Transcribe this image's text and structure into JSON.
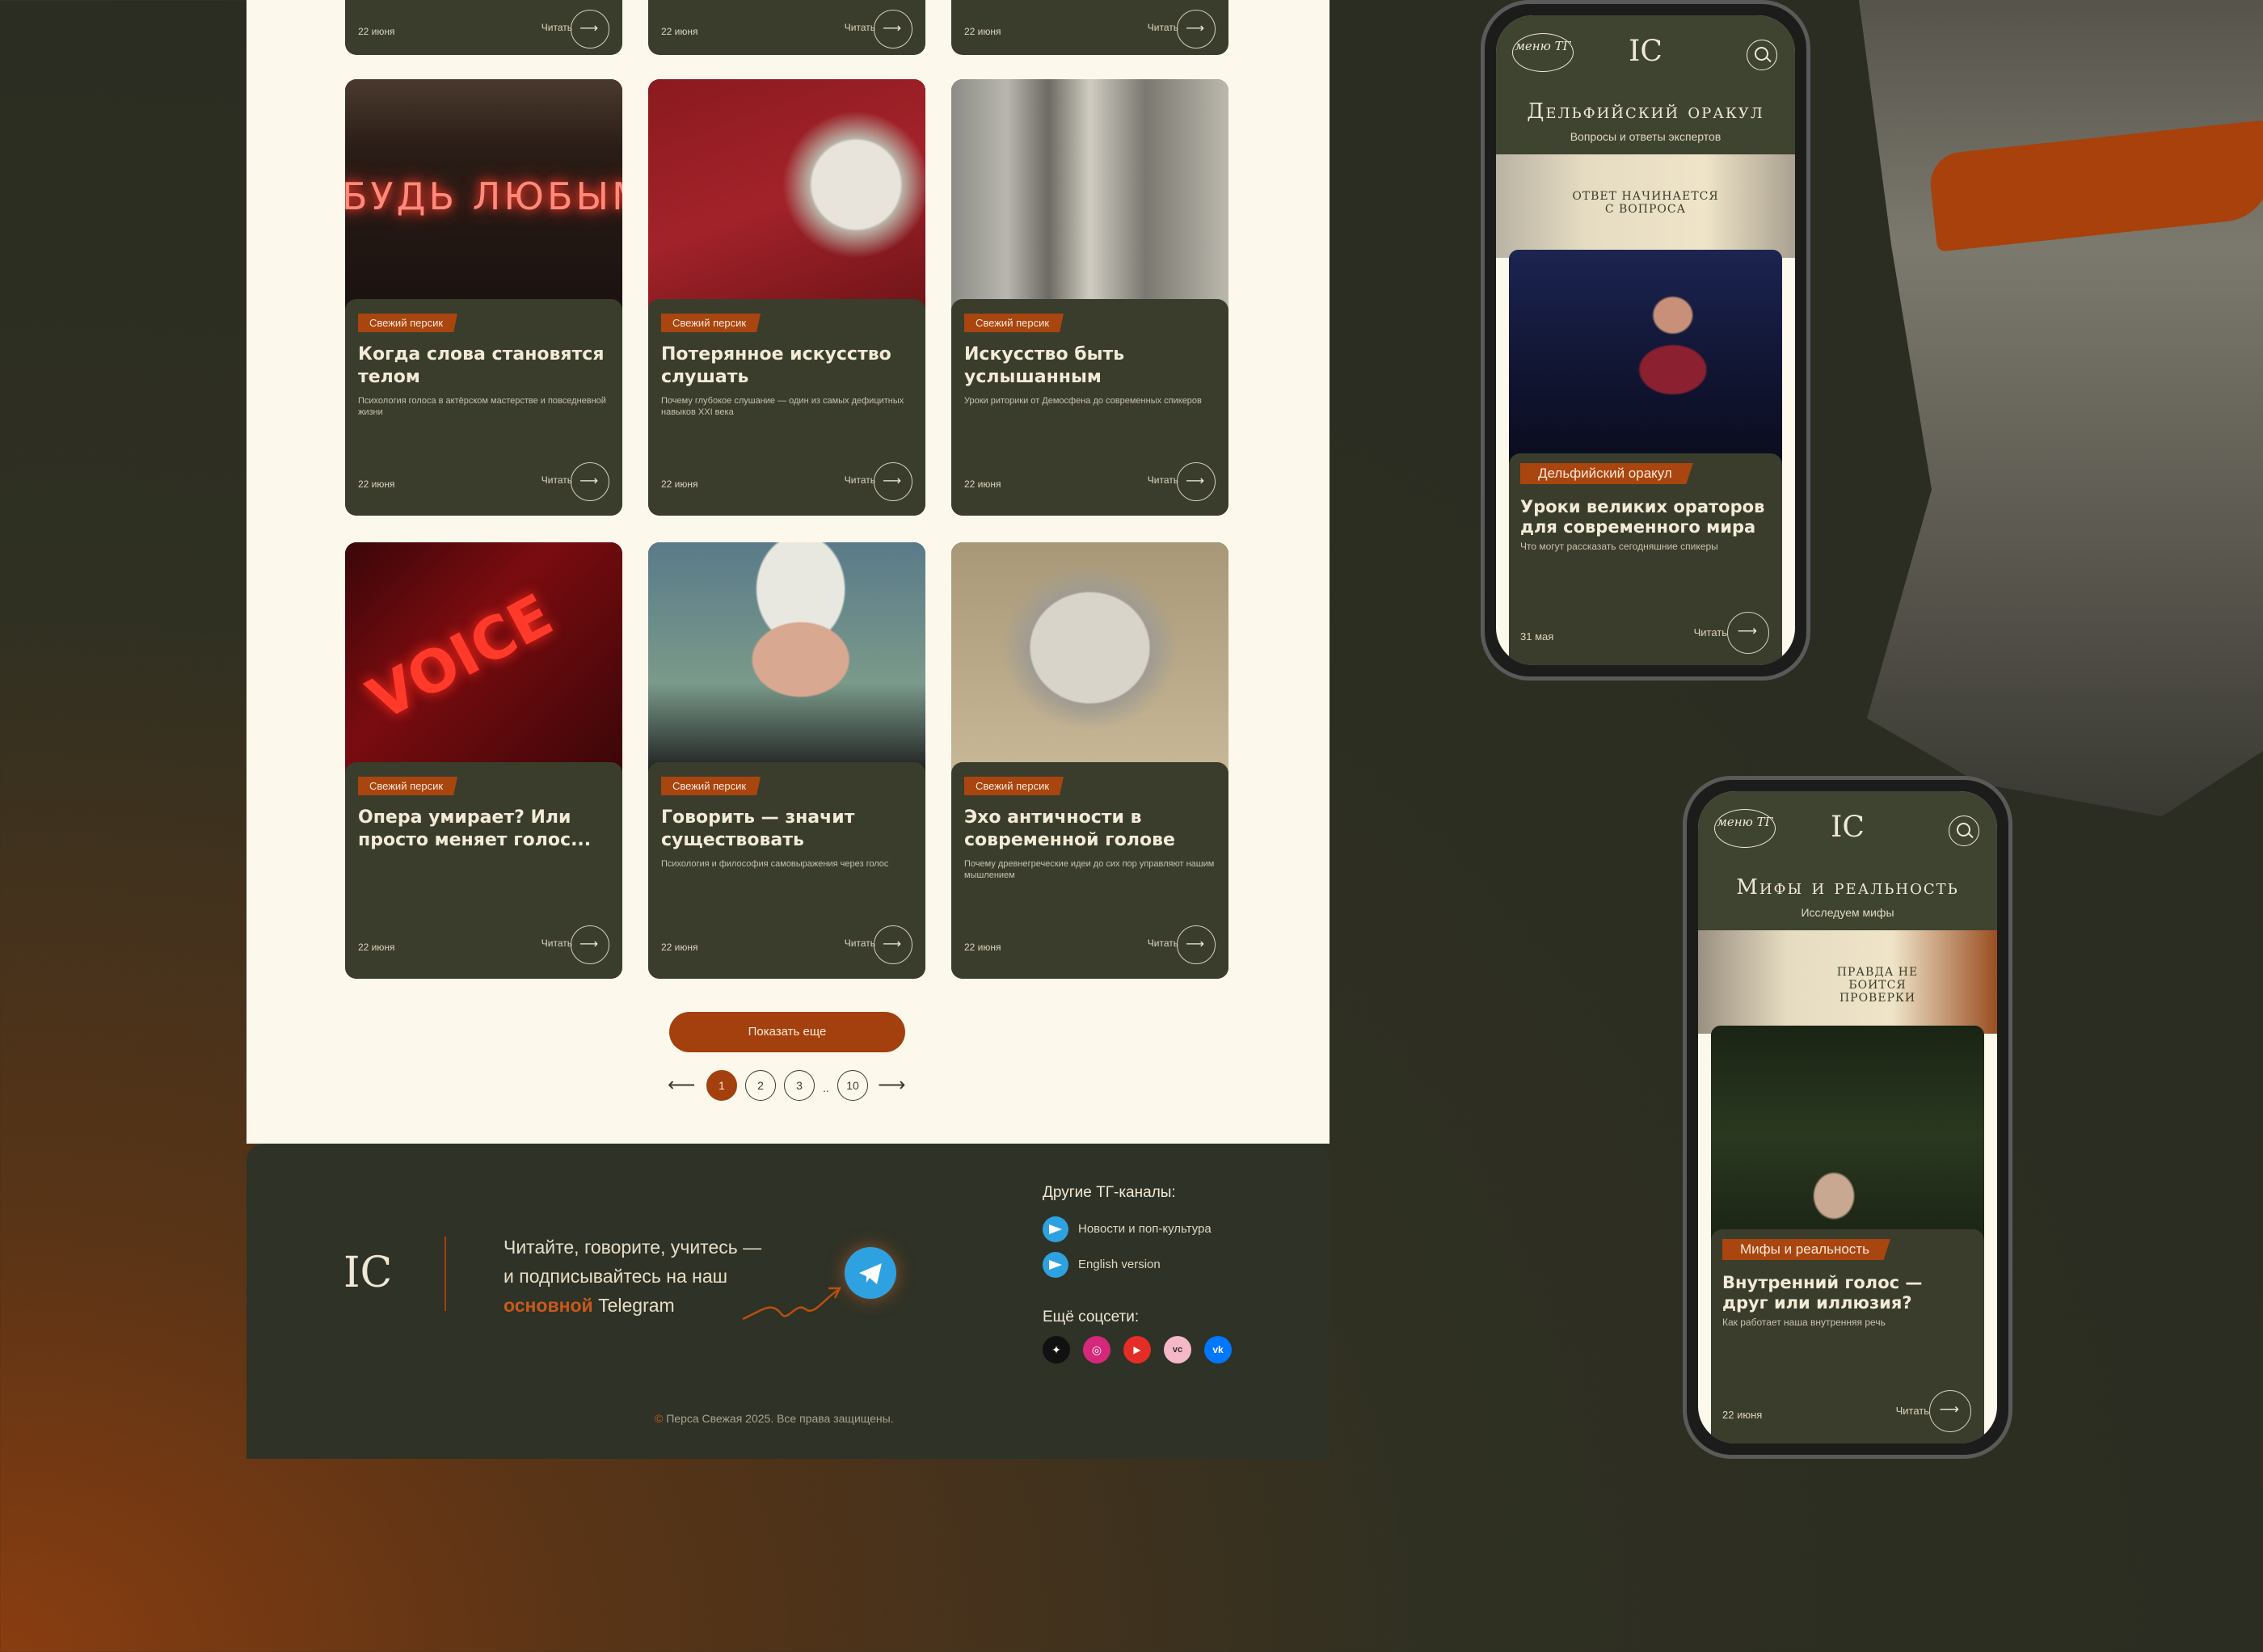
{
  "card_badge": "Свежий персик",
  "read_label": "Читать",
  "top_row": [
    {
      "date": "22 июня"
    },
    {
      "date": "22 июня"
    },
    {
      "date": "22 июня"
    }
  ],
  "cards": [
    {
      "title": "Когда слова становятся телом",
      "subtitle": "Психология голоса в актёрском мастерстве и повседневной жизни",
      "date": "22 июня",
      "neon": "БУДЬ ЛЮБЫМ"
    },
    {
      "title": "Потерянное искусство слушать",
      "subtitle": "Почему глубокое слушание — один из самых дефицитных навыков XXI века",
      "date": "22 июня"
    },
    {
      "title": "Искусство быть услышанным",
      "subtitle": "Уроки риторики от Демосфена до современных спикеров",
      "date": "22 июня"
    },
    {
      "title": "Опера умирает? Или просто меняет голос...",
      "subtitle": "",
      "date": "22 июня",
      "neon": "VOICE"
    },
    {
      "title": "Говорить — значит существовать",
      "subtitle": "Психология и философия самовыражения через голос",
      "date": "22 июня"
    },
    {
      "title": "Эхо античности в современной голове",
      "subtitle": "Почему древнегреческие идеи до сих пор управляют нашим мышлением",
      "date": "22 июня"
    }
  ],
  "show_more": "Показать еще",
  "pagination": {
    "pages": [
      "1",
      "2",
      "3",
      "10"
    ],
    "active": "1",
    "ellipsis": "..",
    "prev": "⟵",
    "next": "⟶"
  },
  "footer": {
    "logo": "ІС",
    "cta_line1": "Читайте, говорите, учитесь —",
    "cta_line2": "и подписывайтесь на наш",
    "cta_accent": "основной",
    "cta_tail": "Telegram",
    "channels_title": "Другие ТГ-каналы:",
    "channels": [
      "Новости и поп-культура",
      "English version"
    ],
    "socials_title": "Ещё соцсети:",
    "socials": [
      {
        "icon": "star-icon",
        "color": "#111111",
        "glyph": "✦"
      },
      {
        "icon": "instagram-icon",
        "color": "#d6287a",
        "glyph": "◎"
      },
      {
        "icon": "youtube-icon",
        "color": "#e52d27",
        "glyph": "▶"
      },
      {
        "icon": "vc-icon",
        "color": "#f4b8c8",
        "glyph": "vc"
      },
      {
        "icon": "vk-icon",
        "color": "#0077ff",
        "glyph": "vk"
      }
    ],
    "copyright_symbol": "©",
    "copyright": "Перса Свежая 2025. Все права защищены."
  },
  "phones": [
    {
      "menu": "меню ТГ",
      "logo": "ІС",
      "title": "Дельфийский оракул",
      "subtitle": "Вопросы и ответы экспертов",
      "banner": "ответ начинается с вопроса",
      "badge": "Дельфийский оракул",
      "card_title": "Уроки великих ораторов для современного мира",
      "card_sub": "Что могут рассказать сегодняшние спикеры",
      "date": "31 мая",
      "read": "Читать"
    },
    {
      "menu": "меню ТГ",
      "logo": "ІС",
      "title": "Мифы и реальность",
      "subtitle": "Исследуем мифы",
      "banner": "правда не боится проверки",
      "badge": "Мифы и реальность",
      "card_title": "Внутренний голос — друг или иллюзия?",
      "card_sub": "Как работает наша внутренняя речь",
      "date": "22 июня",
      "read": "Читать"
    }
  ],
  "colors": {
    "accent": "#a3400e",
    "dark": "#3a3d2c",
    "paper": "#fdf8ec",
    "telegram": "#2ea2e0"
  }
}
